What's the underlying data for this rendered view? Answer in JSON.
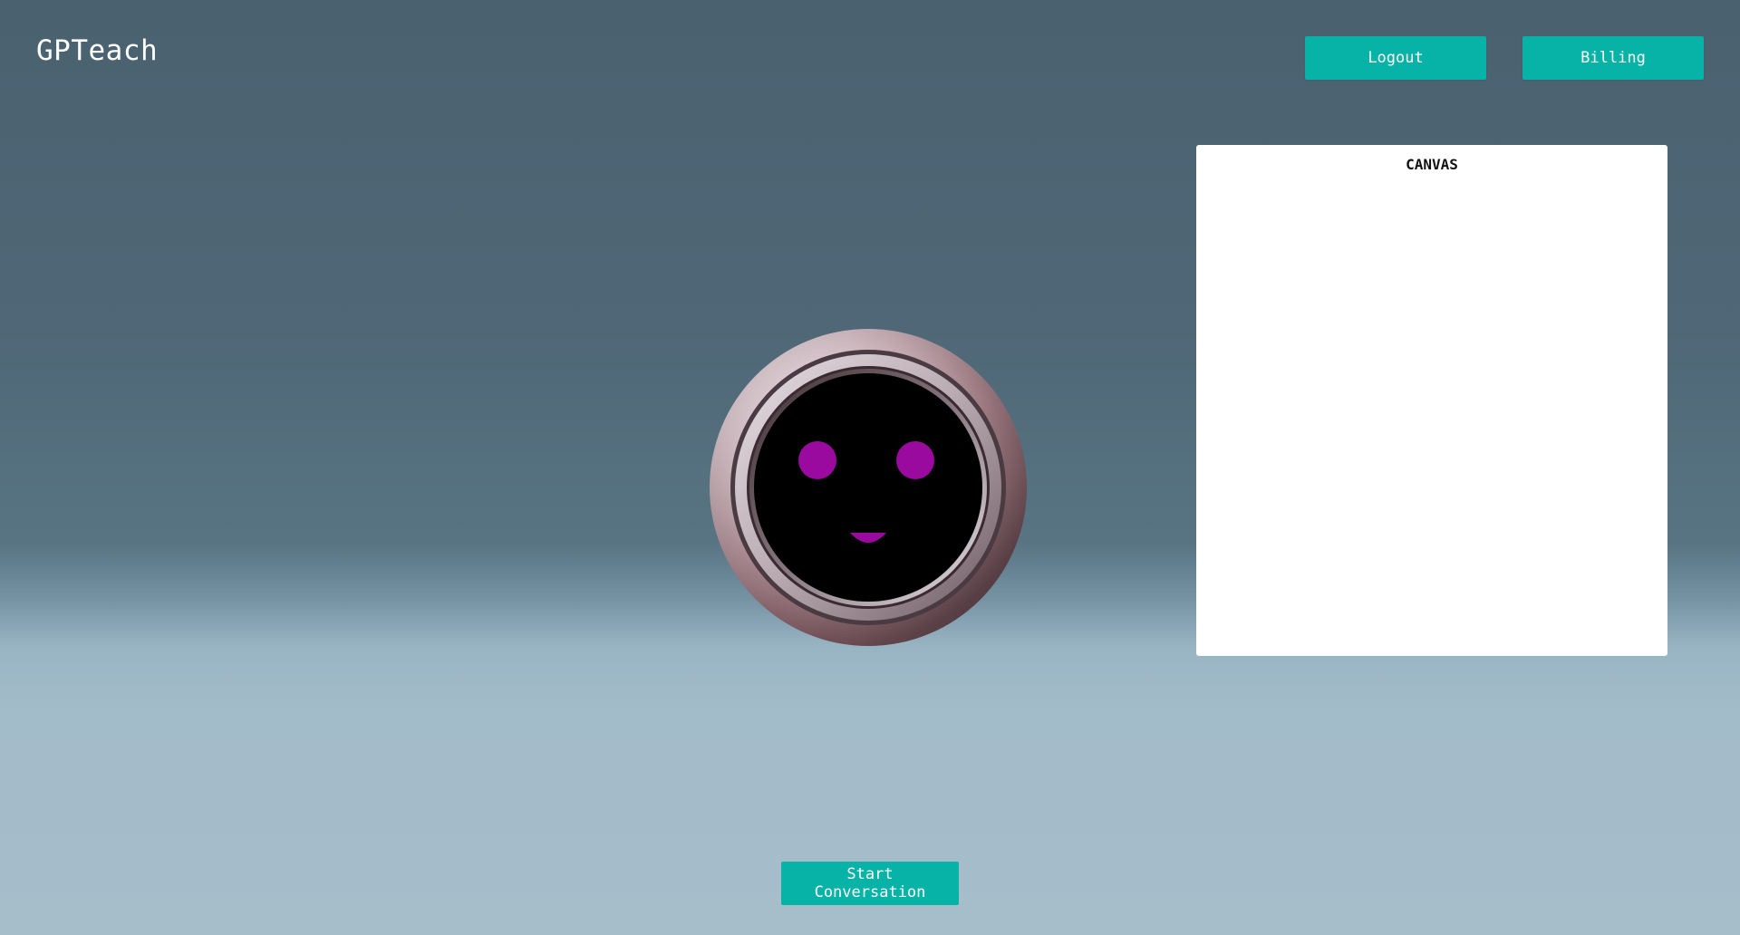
{
  "app": {
    "title": "GPTeach"
  },
  "header": {
    "logout_label": "Logout",
    "billing_label": "Billing"
  },
  "canvas": {
    "title": "CANVAS"
  },
  "avatar": {
    "icon": "robot-face-icon",
    "face_color": "#000000",
    "feature_color": "#9b0a9e"
  },
  "actions": {
    "start_label": "Start Conversation"
  },
  "colors": {
    "accent": "#07b3a6",
    "background_top": "#4a6270",
    "background_bottom": "#a6bdca",
    "panel": "#ffffff"
  }
}
